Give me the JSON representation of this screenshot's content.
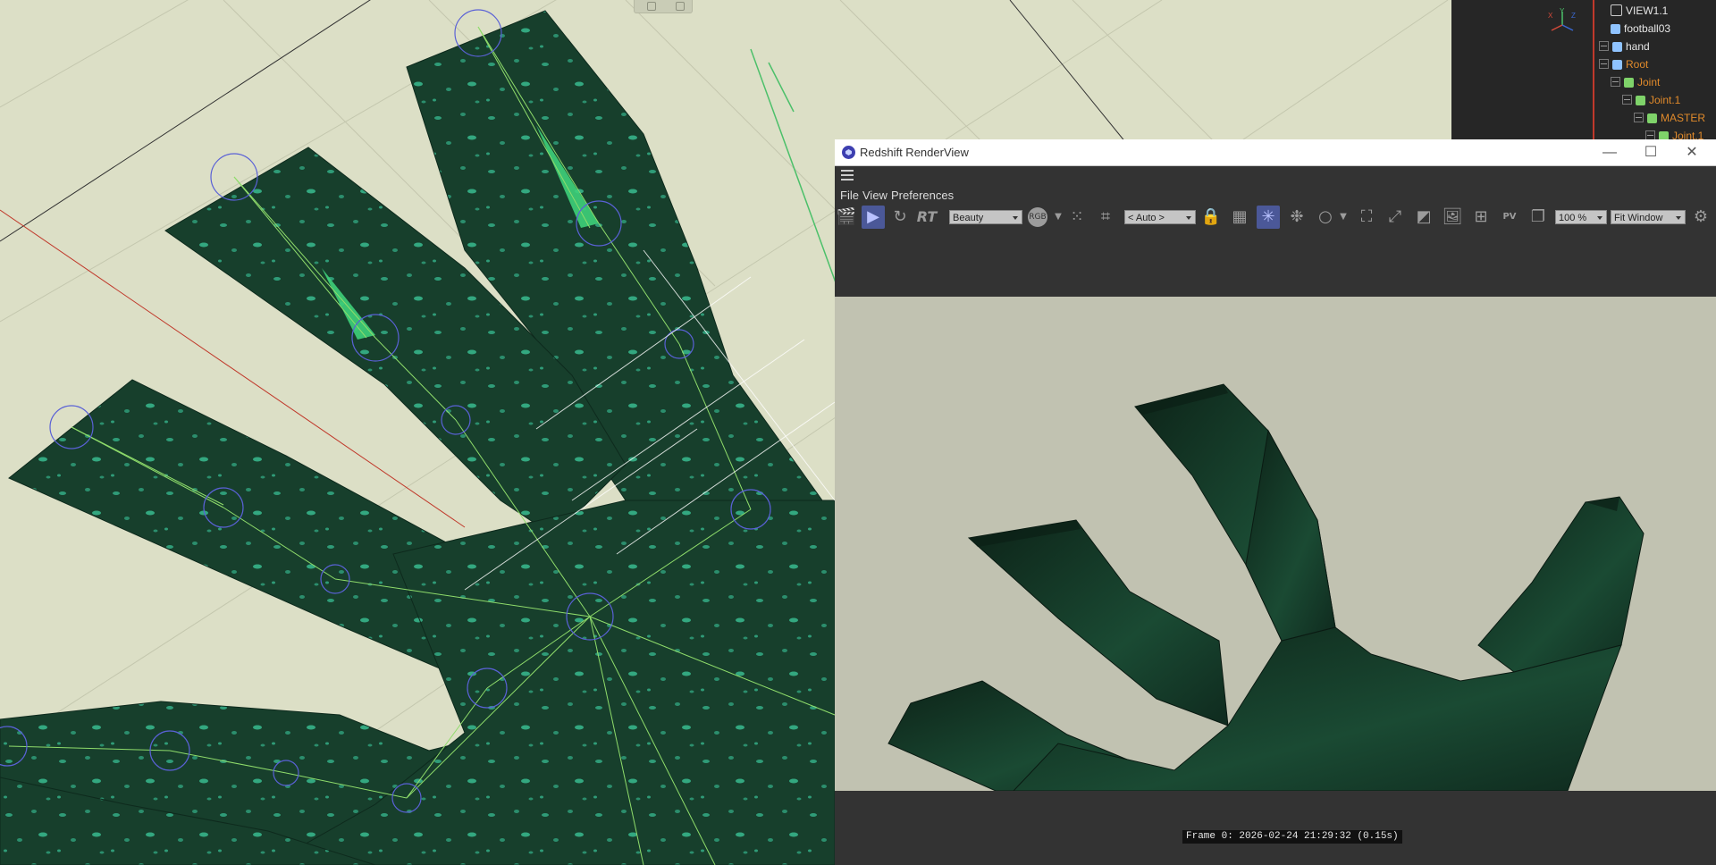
{
  "object_manager": {
    "items": [
      {
        "label": "VIEW1.1",
        "color": "white"
      },
      {
        "label": "football03",
        "color": "white"
      },
      {
        "label": "hand",
        "color": "white"
      },
      {
        "label": "Root",
        "color": "orange"
      },
      {
        "label": "Joint",
        "color": "orange"
      },
      {
        "label": "Joint.1",
        "color": "orange"
      },
      {
        "label": "MASTER",
        "color": "orange"
      },
      {
        "label": "Joint.1",
        "color": "orange"
      }
    ],
    "axis": {
      "x": "X",
      "y": "Y",
      "z": "Z"
    }
  },
  "renderview": {
    "title": "Redshift RenderView",
    "window_buttons": {
      "minimize": "—",
      "maximize": "☐",
      "close": "✕"
    },
    "menu": {
      "file": "File",
      "view": "View",
      "preferences": "Preferences"
    },
    "toolbar": {
      "rt_label": "RT",
      "aov_select": "Beauty",
      "rgb_label": "RGB",
      "region_select": "< Auto >",
      "pv_label": "PV",
      "zoom_value": "100 %",
      "fit_select": "Fit Window"
    },
    "status": {
      "frame_info": "Frame  0:  2026-02-24  21:29:32  (0.15s)"
    }
  },
  "colors": {
    "viewport_bg": "#dcdfc6",
    "hand_green": "#163a29",
    "highlight_blue": "#4b5898",
    "render_bg": "#c1c2b1"
  }
}
